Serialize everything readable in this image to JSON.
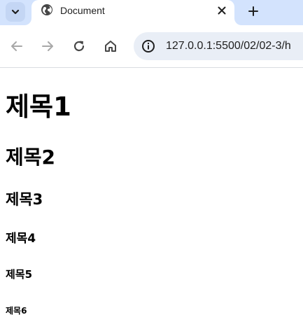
{
  "browser": {
    "active_tab": {
      "title": "Document",
      "favicon": "globe-icon"
    },
    "tab_search_icon": "chevron-down-icon",
    "tab_close_icon": "close-icon",
    "new_tab_icon": "plus-icon",
    "toolbar": {
      "back_icon": "arrow-left-icon",
      "forward_icon": "arrow-right-icon",
      "reload_icon": "reload-icon",
      "home_icon": "home-icon",
      "site_info_icon": "info-icon"
    },
    "url": "127.0.0.1:5500/02/02-3/h"
  },
  "colors": {
    "tab_strip_bg": "#d3e3fd",
    "omnibox_bg": "#e9eef6",
    "icon_color": "#474747",
    "disabled_icon_color": "#a8a8a8"
  },
  "page": {
    "headings": {
      "h1": "제목1",
      "h2": "제목2",
      "h3": "제목3",
      "h4": "제목4",
      "h5": "제목5",
      "h6": "제목6"
    }
  }
}
